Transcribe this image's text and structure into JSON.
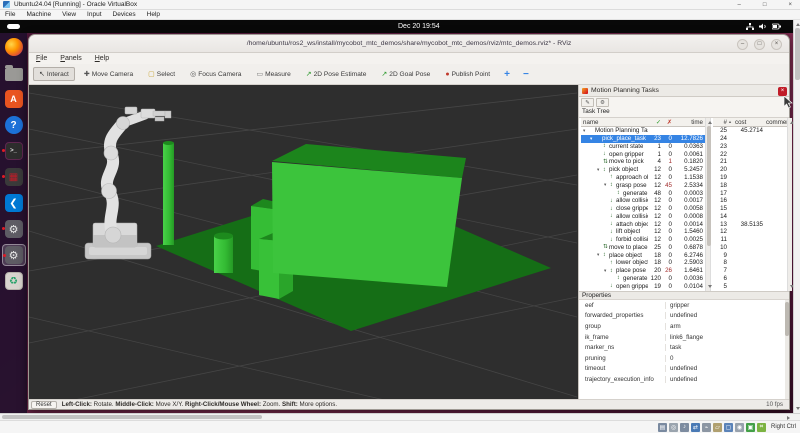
{
  "vbox": {
    "title": "Ubuntu24.04 [Running] - Oracle VirtualBox",
    "menu": [
      "File",
      "Machine",
      "View",
      "Input",
      "Devices",
      "Help"
    ],
    "window_buttons": [
      "–",
      "□",
      "×"
    ],
    "host_key": "Right Ctrl",
    "status_icons": [
      {
        "name": "hard-disks",
        "glyph": "▤",
        "color": "#7a8aa0"
      },
      {
        "name": "optical-drives",
        "glyph": "◎",
        "color": "#9aa4ae"
      },
      {
        "name": "audio",
        "glyph": "♪",
        "color": "#7d8ca0"
      },
      {
        "name": "network",
        "glyph": "⇄",
        "color": "#4a7ab5"
      },
      {
        "name": "usb",
        "glyph": "⌁",
        "color": "#8c96a3"
      },
      {
        "name": "shared-folders",
        "glyph": "▱",
        "color": "#b0a070"
      },
      {
        "name": "display",
        "glyph": "▢",
        "color": "#5b83b8"
      },
      {
        "name": "recording",
        "glyph": "◉",
        "color": "#98a2ad"
      },
      {
        "name": "features",
        "glyph": "▣",
        "color": "#43a047"
      },
      {
        "name": "keyboard",
        "glyph": "⌗",
        "color": "#7cb342"
      }
    ]
  },
  "ubuntu": {
    "clock": "Dec 20 19:54"
  },
  "dock": {
    "items": [
      {
        "name": "firefox",
        "cls": "ic-firefox",
        "glyph": "",
        "running": false,
        "active": false
      },
      {
        "name": "files",
        "cls": "ic-files",
        "glyph": "",
        "running": false,
        "active": false
      },
      {
        "name": "ubuntu-software",
        "cls": "ic-software",
        "glyph": "A",
        "running": false,
        "active": false
      },
      {
        "name": "help",
        "cls": "ic-help",
        "glyph": "?",
        "running": false,
        "active": false
      },
      {
        "name": "terminal",
        "cls": "ic-terminal",
        "glyph": ">_",
        "running": true,
        "active": false
      },
      {
        "name": "red-app",
        "cls": "ic-redapp",
        "glyph": "▦",
        "running": true,
        "active": false
      },
      {
        "name": "vscode",
        "cls": "ic-vscode",
        "glyph": "❮",
        "running": false,
        "active": false
      },
      {
        "name": "settings",
        "cls": "ic-gear",
        "glyph": "⚙",
        "running": true,
        "active": false
      },
      {
        "name": "settings-active",
        "cls": "ic-gear",
        "glyph": "⚙",
        "running": true,
        "active": true
      },
      {
        "name": "trash",
        "cls": "ic-trash",
        "glyph": "♻",
        "running": false,
        "active": false
      }
    ]
  },
  "rviz": {
    "title": "/home/ubuntu/ros2_ws/install/mycobot_mtc_demos/share/mycobot_mtc_demos/rviz/mtc_demos.rviz* - RViz",
    "menu": [
      "File",
      "Panels",
      "Help"
    ],
    "window_buttons": [
      "–",
      "□",
      "×"
    ],
    "toolbar": {
      "tools": [
        {
          "label": "Interact",
          "icon": "↖",
          "color": "#444444",
          "active": true
        },
        {
          "label": "Move Camera",
          "icon": "✚",
          "color": "#555555",
          "active": false
        },
        {
          "label": "Select",
          "icon": "▢",
          "color": "#c8a432",
          "active": false
        },
        {
          "label": "Focus Camera",
          "icon": "◎",
          "color": "#555555",
          "active": false
        },
        {
          "label": "Measure",
          "icon": "▭",
          "color": "#777777",
          "active": false
        },
        {
          "label": "2D Pose Estimate",
          "icon": "↗",
          "color": "#2d9a2d",
          "active": false
        },
        {
          "label": "2D Goal Pose",
          "icon": "↗",
          "color": "#2d9a2d",
          "active": false
        },
        {
          "label": "Publish Point",
          "icon": "●",
          "color": "#c0392b",
          "active": false
        }
      ],
      "add_label": "+",
      "remove_label": "−"
    },
    "statusbar": {
      "reset": "Reset",
      "help": [
        [
          "Left-Click:",
          "Rotate."
        ],
        [
          "Middle-Click:",
          "Move X/Y."
        ],
        [
          "Right-Click/Mouse Wheel:",
          "Zoom."
        ],
        [
          "Shift:",
          "More options."
        ]
      ],
      "fps": "10 fps"
    }
  },
  "tasks_panel": {
    "title": "Motion Planning Tasks",
    "tool_icons": [
      "✎",
      "⚙"
    ],
    "tree_label": "Task Tree",
    "columns": [
      "name",
      "✓",
      "✗",
      "time"
    ],
    "solution_columns": [
      "#",
      "cost",
      "comment"
    ],
    "sort_icon": "▴",
    "rows": [
      {
        "level": 0,
        "expand": "▾",
        "icon": "",
        "name": "Motion Planning Tasks",
        "s": "",
        "f": "",
        "time": "",
        "selected": false
      },
      {
        "level": 1,
        "expand": "▾",
        "icon": "",
        "name": "pick_place_task",
        "s": "23",
        "f": "0",
        "time": "12.7826",
        "selected": true
      },
      {
        "level": 2,
        "expand": "",
        "icon": "↕",
        "name": "current state",
        "s": "1",
        "f": "0",
        "time": "0.0363",
        "selected": false
      },
      {
        "level": 2,
        "expand": "",
        "icon": "↓",
        "name": "open gripper",
        "s": "1",
        "f": "0",
        "time": "0.0061",
        "selected": false
      },
      {
        "level": 2,
        "expand": "",
        "icon": "⇅",
        "name": "move to pick",
        "s": "4",
        "f": "1",
        "time": "0.1820",
        "selected": false
      },
      {
        "level": 2,
        "expand": "▾",
        "icon": "↕",
        "name": "pick object",
        "s": "12",
        "f": "0",
        "time": "5.2457",
        "selected": false
      },
      {
        "level": 3,
        "expand": "",
        "icon": "↑",
        "name": "approach object",
        "s": "12",
        "f": "0",
        "time": "1.1538",
        "selected": false
      },
      {
        "level": 3,
        "expand": "▾",
        "icon": "↕",
        "name": "grasp pose IK",
        "s": "12",
        "f": "45",
        "time": "2.5334",
        "selected": false
      },
      {
        "level": 4,
        "expand": "",
        "icon": "↕",
        "name": "generate gr...",
        "s": "48",
        "f": "0",
        "time": "0.0003",
        "selected": false
      },
      {
        "level": 3,
        "expand": "",
        "icon": "↓",
        "name": "allow collision ...",
        "s": "12",
        "f": "0",
        "time": "0.0017",
        "selected": false
      },
      {
        "level": 3,
        "expand": "",
        "icon": "↓",
        "name": "close gripper",
        "s": "12",
        "f": "0",
        "time": "0.0058",
        "selected": false
      },
      {
        "level": 3,
        "expand": "",
        "icon": "↓",
        "name": "allow collision ...",
        "s": "12",
        "f": "0",
        "time": "0.0008",
        "selected": false
      },
      {
        "level": 3,
        "expand": "",
        "icon": "↓",
        "name": "attach object",
        "s": "12",
        "f": "0",
        "time": "0.0014",
        "selected": false
      },
      {
        "level": 3,
        "expand": "",
        "icon": "↓",
        "name": "lift object",
        "s": "12",
        "f": "0",
        "time": "1.5460",
        "selected": false
      },
      {
        "level": 3,
        "expand": "",
        "icon": "↓",
        "name": "forbid collisio...",
        "s": "12",
        "f": "0",
        "time": "0.0025",
        "selected": false
      },
      {
        "level": 2,
        "expand": "",
        "icon": "⇅",
        "name": "move to place",
        "s": "25",
        "f": "0",
        "time": "0.6878",
        "selected": false
      },
      {
        "level": 2,
        "expand": "▾",
        "icon": "↕",
        "name": "place object",
        "s": "18",
        "f": "0",
        "time": "6.2746",
        "selected": false
      },
      {
        "level": 3,
        "expand": "",
        "icon": "↑",
        "name": "lower object",
        "s": "18",
        "f": "0",
        "time": "2.5903",
        "selected": false
      },
      {
        "level": 3,
        "expand": "▾",
        "icon": "↕",
        "name": "place pose IK",
        "s": "20",
        "f": "26",
        "time": "1.6461",
        "selected": false
      },
      {
        "level": 4,
        "expand": "",
        "icon": "↕",
        "name": "generate pl...",
        "s": "120",
        "f": "0",
        "time": "0.0036",
        "selected": false
      },
      {
        "level": 3,
        "expand": "",
        "icon": "↓",
        "name": "open gripper",
        "s": "19",
        "f": "0",
        "time": "0.0104",
        "selected": false
      }
    ],
    "solutions": [
      {
        "n": "25",
        "cost": "45.2714"
      },
      {
        "n": "24",
        "cost": ""
      },
      {
        "n": "23",
        "cost": ""
      },
      {
        "n": "22",
        "cost": ""
      },
      {
        "n": "21",
        "cost": ""
      },
      {
        "n": "20",
        "cost": ""
      },
      {
        "n": "19",
        "cost": ""
      },
      {
        "n": "18",
        "cost": ""
      },
      {
        "n": "17",
        "cost": ""
      },
      {
        "n": "16",
        "cost": ""
      },
      {
        "n": "15",
        "cost": ""
      },
      {
        "n": "14",
        "cost": ""
      },
      {
        "n": "13",
        "cost": "38.5135"
      },
      {
        "n": "12",
        "cost": ""
      },
      {
        "n": "11",
        "cost": ""
      },
      {
        "n": "10",
        "cost": ""
      },
      {
        "n": "9",
        "cost": ""
      },
      {
        "n": "8",
        "cost": ""
      },
      {
        "n": "7",
        "cost": ""
      },
      {
        "n": "6",
        "cost": ""
      },
      {
        "n": "5",
        "cost": ""
      }
    ],
    "properties_label": "Properties",
    "properties": [
      {
        "key": "eef",
        "value": "gripper"
      },
      {
        "key": "forwarded_properties",
        "value": "undefined"
      },
      {
        "key": "group",
        "value": "arm"
      },
      {
        "key": "ik_frame",
        "value": "link6_flange"
      },
      {
        "key": "marker_ns",
        "value": "task"
      },
      {
        "key": "pruning",
        "value": "0"
      },
      {
        "key": "timeout",
        "value": "undefined"
      },
      {
        "key": "trajectory_execution_info",
        "value": "undefined"
      }
    ]
  }
}
